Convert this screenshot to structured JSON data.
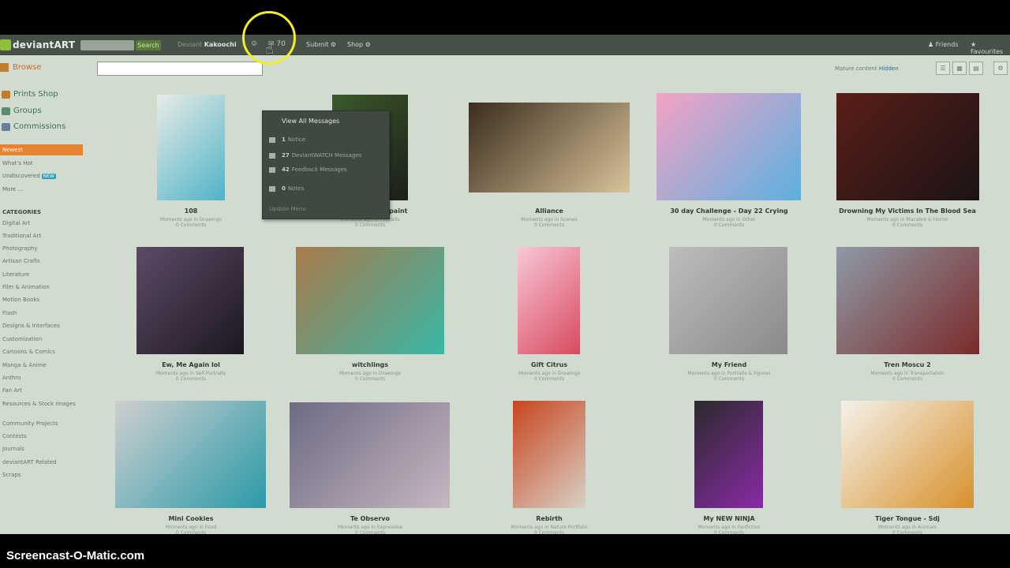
{
  "topbar": {
    "logo": "deviantART",
    "search_button": "Search",
    "user_prefix": "Deviant",
    "username": "Kakoochi",
    "messages_count": "70",
    "submit": "Submit",
    "shop": "Shop",
    "friends": "Friends",
    "favourites": "Favourites"
  },
  "dropdown": {
    "header": "View All Messages",
    "items": [
      {
        "count": "1",
        "label": "Notice",
        "icon": "notice-icon"
      },
      {
        "count": "27",
        "label": "DeviantWATCH Messages",
        "icon": "watch-icon"
      },
      {
        "count": "42",
        "label": "Feedback Messages",
        "icon": "feedback-icon"
      },
      {
        "count": "0",
        "label": "Notes",
        "icon": "notes-icon"
      }
    ],
    "update": "Update Menu"
  },
  "sidebar": {
    "browse": "Browse",
    "links": [
      {
        "label": "Prints Shop",
        "color": "#c17b2e"
      },
      {
        "label": "Groups",
        "color": "#5c8a6c"
      },
      {
        "label": "Commissions",
        "color": "#6b7d9a"
      }
    ],
    "active": "Newest",
    "nav": [
      "What's Hot",
      "Undiscovered",
      "More ..."
    ],
    "new_badge": "NEW",
    "categories_title": "CATEGORIES",
    "categories": [
      "Digital Art",
      "Traditional Art",
      "Photography",
      "Artisan Crafts",
      "Literature",
      "Film & Animation",
      "Motion Books",
      "Flash",
      "Designs & Interfaces",
      "Customization",
      "Cartoons & Comics",
      "Manga & Anime",
      "Anthro",
      "Fan Art",
      "Resources & Stock Images",
      "Community Projects",
      "Contests",
      "Journals",
      "deviantART Related",
      "Scraps"
    ]
  },
  "main": {
    "mature": "Mature content",
    "mature_state": "Hidden"
  },
  "gallery": [
    {
      "title": "108",
      "sub": "Moments ago in Drawings",
      "comments": "0 Comments",
      "colors": [
        "#e8ece6",
        "#4fb3c8"
      ]
    },
    {
      "title": "Lucy Liu digital paint",
      "sub": "Moments ago in Portraits",
      "comments": "0 Comments",
      "colors": [
        "#3c5a2a",
        "#1b1f1a"
      ]
    },
    {
      "title": "Alliance",
      "sub": "Moments ago in Scenes",
      "comments": "0 Comments",
      "colors": [
        "#3a2c1d",
        "#d8c49a"
      ]
    },
    {
      "title": "30 day Challenge - Day 22 Crying",
      "sub": "Moments ago in Other",
      "comments": "0 Comments",
      "colors": [
        "#f2a3c4",
        "#5cb0e0"
      ]
    },
    {
      "title": "Drowning My Victims In The Blood Sea",
      "sub": "Moments ago in Macabre & Horror",
      "comments": "0 Comments",
      "colors": [
        "#5a1e18",
        "#1a1414"
      ]
    },
    {
      "title": "Ew, Me Again lol",
      "sub": "Moments ago in Self-Portraits",
      "comments": "0 Comments",
      "colors": [
        "#5d4a66",
        "#1c1720"
      ]
    },
    {
      "title": "witchlings",
      "sub": "Moments ago in Drawings",
      "comments": "0 Comments",
      "colors": [
        "#a87a4a",
        "#3ab7a6"
      ]
    },
    {
      "title": "Gift Citrus",
      "sub": "Moments ago in Drawings",
      "comments": "0 Comments",
      "colors": [
        "#f8c7d7",
        "#d84a5e"
      ]
    },
    {
      "title": "My Friend",
      "sub": "Moments ago in Portraits & Figures",
      "comments": "0 Comments",
      "colors": [
        "#bdbdbd",
        "#8a8a8a"
      ]
    },
    {
      "title": "Tren Moscu 2",
      "sub": "Moments ago in Transportation",
      "comments": "0 Comments",
      "colors": [
        "#8e9aa6",
        "#7a2a2a"
      ]
    },
    {
      "title": "Mini Cookies",
      "sub": "Moments ago in Food",
      "comments": "0 Comments",
      "colors": [
        "#cfcfcf",
        "#2a9aa8"
      ]
    },
    {
      "title": "Te Observo",
      "sub": "Moments ago in Expressive",
      "comments": "0 Comments",
      "colors": [
        "#6d6a82",
        "#c7b7c2"
      ]
    },
    {
      "title": "Rebirth",
      "sub": "Moments ago in Nature Portfolio",
      "comments": "0 Comments",
      "colors": [
        "#c8451e",
        "#d8d0c6"
      ]
    },
    {
      "title": "My NEW NINJA",
      "sub": "Moments ago in Fanfiction",
      "comments": "0 Comments",
      "colors": [
        "#2a2a2a",
        "#8a2aa8"
      ]
    },
    {
      "title": "Tiger Tongue - Sdj",
      "sub": "Moments ago in Animals",
      "comments": "0 Comments",
      "colors": [
        "#f4f2ec",
        "#d8902a"
      ]
    }
  ],
  "watermark": "Screencast-O-Matic.com"
}
